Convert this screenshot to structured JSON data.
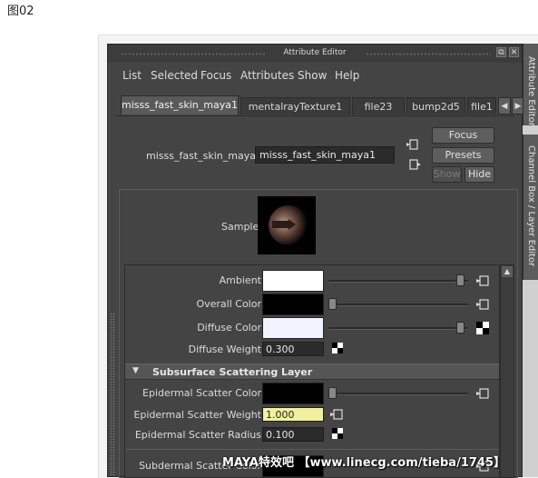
{
  "caption": "图02",
  "window": {
    "title": "Attribute Editor"
  },
  "menu": [
    "List",
    "Selected",
    "Focus",
    "Attributes",
    "Show",
    "Help"
  ],
  "tabs": [
    {
      "label": "misss_fast_skin_maya1",
      "active": true
    },
    {
      "label": "mentalrayTexture1"
    },
    {
      "label": "file23"
    },
    {
      "label": "bump2d5"
    },
    {
      "label": "file1"
    }
  ],
  "node": {
    "label": "misss_fast_skin_maya:",
    "value": "misss_fast_skin_maya1"
  },
  "buttons": {
    "focus": "Focus",
    "presets": "Presets",
    "show": "Show",
    "hide": "Hide"
  },
  "sample": {
    "label": "Sample"
  },
  "attributes": {
    "ambient": {
      "label": "Ambient",
      "color": "#ffffff",
      "level": 0.97
    },
    "overall_color": {
      "label": "Overall Color",
      "color": "#000000",
      "level": 0.0
    },
    "diffuse_color": {
      "label": "Diffuse Color",
      "color": "#f2f2ff",
      "level": 0.97
    },
    "diffuse_weight": {
      "label": "Diffuse Weight",
      "value": "0.300"
    }
  },
  "section": {
    "title": "Subsurface Scattering Layer"
  },
  "sss": {
    "epidermal_color": {
      "label": "Epidermal Scatter Color",
      "color": "#000000",
      "level": 0.0
    },
    "epidermal_weight": {
      "label": "Epidermal Scatter Weight",
      "value": "1.000"
    },
    "epidermal_radius": {
      "label": "Epidermal Scatter Radius",
      "value": "0.100"
    },
    "subdermal_color": {
      "label": "Subdermal Scatter Color"
    }
  },
  "side_tabs": [
    "Attribute Editor",
    "Channel Box / Layer Editor"
  ],
  "watermark": "MAYA特效吧 【www.linecg.com/tieba/1745】"
}
